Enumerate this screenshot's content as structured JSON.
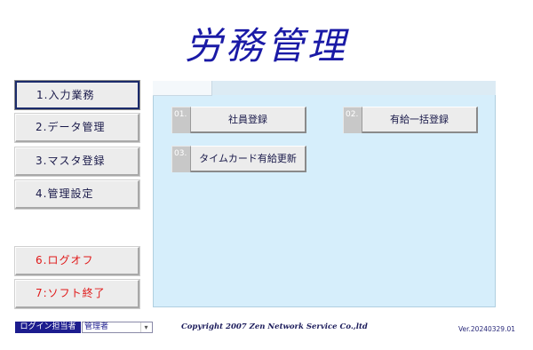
{
  "app": {
    "title": "労務管理"
  },
  "nav": {
    "items": [
      {
        "label": "1.入力業務"
      },
      {
        "label": "2.データ管理"
      },
      {
        "label": "3.マスタ登録"
      },
      {
        "label": "4.管理設定"
      },
      {
        "label": "6.ログオフ"
      },
      {
        "label": "7:ソフト終了"
      }
    ],
    "active_index": 0
  },
  "panel": {
    "functions": [
      {
        "num": "01.",
        "label": "社員登録"
      },
      {
        "num": "02.",
        "label": "有給一括登録"
      },
      {
        "num": "03.",
        "label": "タイムカード有給更新"
      }
    ]
  },
  "footer": {
    "login_label": "ログイン担当者",
    "login_value": "管理者",
    "copyright": "Copyright 2007 Zen Network Service Co.,ltd",
    "version": "Ver.20240329.01"
  },
  "colors": {
    "title": "#1a1aa6",
    "logoff": "#e01818",
    "panel_bg": "#d6eefb"
  }
}
